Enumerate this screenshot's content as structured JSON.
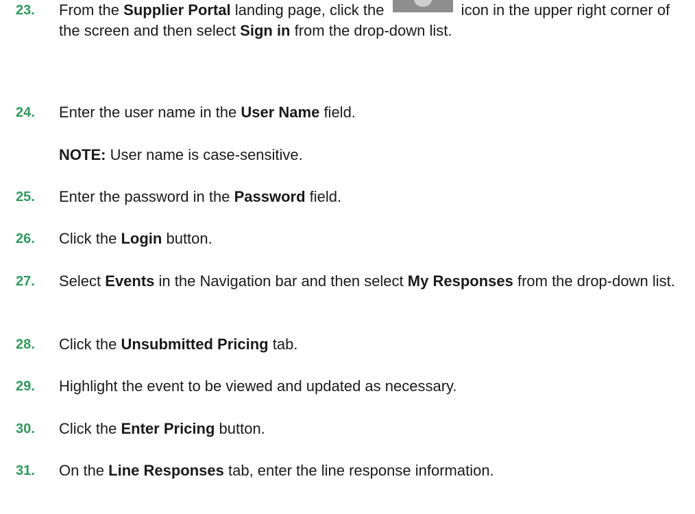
{
  "steps": [
    {
      "num": "23.",
      "parts": [
        {
          "t": "From the "
        },
        {
          "b": "Supplier Portal"
        },
        {
          "t": " landing page, click the "
        },
        {
          "icon": "user-profile-icon"
        },
        {
          "t": " icon in the upper right corner of the screen and then select "
        },
        {
          "b": "Sign in"
        },
        {
          "t": " from the drop-down list."
        }
      ]
    },
    {
      "num": "24.",
      "parts": [
        {
          "t": "Enter the user name in the "
        },
        {
          "b": "User Name"
        },
        {
          "t": " field."
        }
      ]
    },
    {
      "num": "25.",
      "parts": [
        {
          "t": "Enter the password in the "
        },
        {
          "b": "Password"
        },
        {
          "t": " field."
        }
      ]
    },
    {
      "num": "26.",
      "parts": [
        {
          "t": "Click the "
        },
        {
          "b": "Login"
        },
        {
          "t": " button."
        }
      ]
    },
    {
      "num": "27.",
      "parts": [
        {
          "t": "Select "
        },
        {
          "b": "Events"
        },
        {
          "t": " in the Navigation bar and then select "
        },
        {
          "b": "My Responses"
        },
        {
          "t": " from the drop-down list."
        }
      ]
    },
    {
      "num": "28.",
      "parts": [
        {
          "t": "Click the "
        },
        {
          "b": "Unsubmitted Pricing"
        },
        {
          "t": " tab."
        }
      ]
    },
    {
      "num": "29.",
      "parts": [
        {
          "t": "Highlight the event to be viewed and updated as necessary."
        }
      ]
    },
    {
      "num": "30.",
      "parts": [
        {
          "t": "Click the "
        },
        {
          "b": "Enter Pricing"
        },
        {
          "t": " button."
        }
      ]
    },
    {
      "num": "31.",
      "parts": [
        {
          "t": "On the "
        },
        {
          "b": "Line Responses"
        },
        {
          "t": " tab, enter the line response information."
        }
      ]
    }
  ],
  "note": {
    "label": "NOTE:",
    "text": " User name is case-sensitive."
  },
  "colors": {
    "step_number": "#2e9a5a",
    "body_text": "#1a1a1a"
  }
}
